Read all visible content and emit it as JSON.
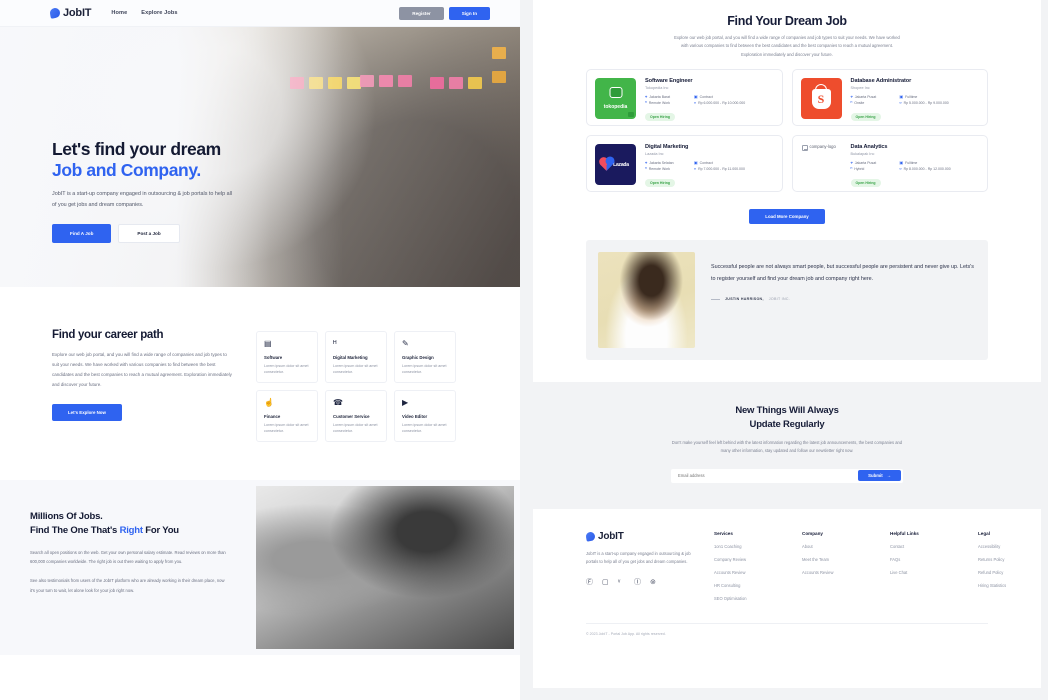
{
  "navbar": {
    "brand": "JobIT",
    "links": [
      {
        "label": "Home"
      },
      {
        "label": "Explore Jobs"
      }
    ],
    "register_label": "Register",
    "signin_label": "Sign In"
  },
  "hero": {
    "title_line1": "Let's find your dream",
    "title_line2": "Job and Company.",
    "paragraph": "JobIT is a start-up company engaged in outsourcing & job portals to help all of you get jobs and dream companies.",
    "find_job_label": "Find A Job",
    "post_job_label": "Post a Job"
  },
  "career": {
    "heading": "Find your career path",
    "paragraph": "Explore our web job portal, and you will find a wide range of companies and job types to suit your needs. We have worked with various companies to find between the best candidates and the best companies to reach a mutual agreement. Exploration immediately and discover your future.",
    "button_label": "Let's Explore Now",
    "categories": [
      {
        "icon": "presentation-chart-icon",
        "glyph": "▤",
        "title": "Software",
        "desc": "Lorem ipsum dolor sit amet consectetur."
      },
      {
        "icon": "bar-chart-icon",
        "glyph": "ᴴ",
        "title": "Digital Marketing",
        "desc": "Lorem ipsum dolor sit amet consectetur."
      },
      {
        "icon": "paint-brush-icon",
        "glyph": "✎",
        "title": "Graphic Design",
        "desc": "Lorem ipsum dolor sit amet consectetur."
      },
      {
        "icon": "hand-coin-icon",
        "glyph": "☝",
        "title": "Finance",
        "desc": "Lorem ipsum dolor sit amet consectetur."
      },
      {
        "icon": "headset-icon",
        "glyph": "☎",
        "title": "Customer Service",
        "desc": "Lorem ipsum dolor sit amet consectetur."
      },
      {
        "icon": "video-play-icon",
        "glyph": "▶",
        "title": "Video Editor",
        "desc": "Lorem ipsum dolor sit amet consectetur."
      }
    ]
  },
  "millions": {
    "line1": "Millions Of Jobs.",
    "line2_a": "Find The One That's ",
    "line2_accent": "Right",
    "line2_b": " For You",
    "paragraph1": "Search all open positions on the web. Get your own personal salary estimate. Read reviews on more than 600,000 companies worldwide. The right job is out there waiting to apply from you.",
    "paragraph2": "See also testimonials from users of the JobIT platform who are already working in their dream place, now it's your turn to wait, let alone look for your job right now."
  },
  "dream": {
    "heading": "Find Your Dream Job",
    "paragraph": "Explore our web job portal, and you will find a wide range of companies and job types to suit your needs. We have worked with various companies to find between the best candidates and the best companies to reach a mutual agreement. Exploration immediately and discover your future.",
    "load_more_label": "Load More Company"
  },
  "jobs": [
    {
      "logo": "tokopedia-logo",
      "logo_word": "tokopedia",
      "logo_kind": "toko",
      "title": "Software Engineer",
      "company": "Tokopedia Inc",
      "location": "Jakarta Barat",
      "type": "Contract",
      "work_mode": "Remote Work",
      "salary": "Rp 6.000.000 - Rp 10.000.000",
      "tag": "Open Hiring"
    },
    {
      "logo": "shopee-logo",
      "logo_word": "",
      "logo_kind": "shopee",
      "title": "Database Administrator",
      "company": "Shopee Inc",
      "location": "Jakarta Pusat",
      "type": "Fulltime",
      "work_mode": "Onsite",
      "salary": "Rp 5.000.000 - Rp 9.000.000",
      "tag": "Open Hiring"
    },
    {
      "logo": "lazada-logo",
      "logo_word": "Lazada",
      "logo_kind": "lazada",
      "title": "Digital Marketing",
      "company": "Lazada Inc",
      "location": "Jakarta Selatan",
      "type": "Contract",
      "work_mode": "Remote Work",
      "salary": "Rp 7.000.000 - Rp 11.000.000",
      "tag": "Open Hiring"
    },
    {
      "logo": "broken-image-icon",
      "logo_word": "company-logo",
      "logo_kind": "broken",
      "title": "Data Analytics",
      "company": "Bukalapak Inc",
      "location": "Jakarta Pusat",
      "type": "Fulltime",
      "work_mode": "Hybrid",
      "salary": "Rp 8.000.000 - Rp 12.000.000",
      "tag": "Open Hiring"
    }
  ],
  "meta_icons": {
    "location": "⌖",
    "type": "▣",
    "work_mode": "ᴴ",
    "salary": "¤"
  },
  "testimonial": {
    "quote": "Successful people are not always smart people, but successful people are persistent and never give up. Lets's to register yourself and find your dream job and company right here.",
    "author": "JUSTIN HARRISON,",
    "org": "JOBIT INC."
  },
  "newsletter": {
    "heading_line1": "New Things Will Always",
    "heading_line2": "Update Regularly",
    "paragraph": "Don't make yourself feel left behind with the latest information regarding the latest job announcements, the best companies and many other information, stay updated and follow our newsletter right now.",
    "input_placeholder": "Email address",
    "input_value": "",
    "submit_label": "Submit",
    "submit_arrow": "→"
  },
  "footer": {
    "brand": "JobIT",
    "description": "JobIT is a start-up company engaged in outsourcing & job portals to help all of you get jobs and dream companies.",
    "socials": [
      {
        "name": "facebook-icon",
        "glyph": "Ⓕ"
      },
      {
        "name": "instagram-icon",
        "glyph": "▢"
      },
      {
        "name": "twitter-icon",
        "glyph": "ᵛ"
      },
      {
        "name": "github-icon",
        "glyph": "Ⓘ"
      },
      {
        "name": "dribbble-icon",
        "glyph": "⊚"
      }
    ],
    "columns": [
      {
        "heading": "Services",
        "items": [
          "1on1 Coaching",
          "Company Review",
          "Accounts Review",
          "HR Consulting",
          "SEO Optimisation"
        ]
      },
      {
        "heading": "Company",
        "items": [
          "About",
          "Meet the Team",
          "Accounts Review"
        ]
      },
      {
        "heading": "Helpful Links",
        "items": [
          "Contact",
          "FAQs",
          "Live Chat"
        ]
      },
      {
        "heading": "Legal",
        "items": [
          "Accessibility",
          "Returns Policy",
          "Refund Policy",
          "Hiring Statistics"
        ]
      }
    ],
    "copyright": "© 2023 JobIT - Portal Job App. All rights reserved."
  },
  "colors": {
    "accent": "#2f63f0",
    "dark": "#171d38",
    "muted": "#8d93a3",
    "tag_bg": "#e4f6e6",
    "tag_text": "#3aa348",
    "page_bg": "#f2f3f5"
  }
}
